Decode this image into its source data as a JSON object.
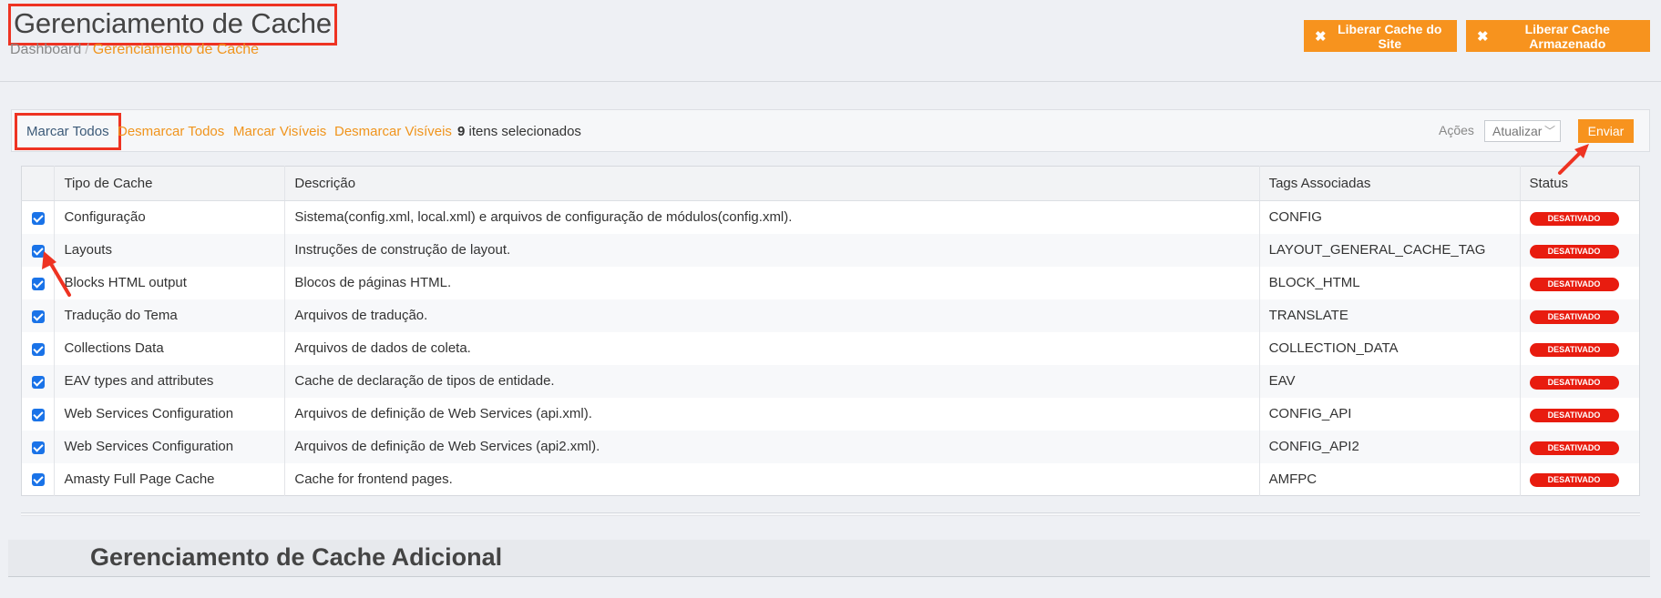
{
  "header": {
    "title": "Gerenciamento de Cache",
    "breadcrumb": {
      "home": "Dashboard",
      "separator": "/",
      "current": "Gerenciamento de Cache"
    },
    "buttons": {
      "liberar_site": "Liberar Cache do Site",
      "liberar_armazenado": "Liberar Cache Armazenado"
    }
  },
  "massaction": {
    "marcar_todos": "Marcar Todos",
    "desmarcar_todos": "Desmarcar Todos",
    "marcar_visiveis": "Marcar Visíveis",
    "desmarcar_visiveis": "Desmarcar Visíveis",
    "selected_count": "9",
    "selected_label": "itens selecionados",
    "acoes_label": "Ações",
    "acoes_selected": "Atualizar",
    "enviar": "Enviar"
  },
  "grid": {
    "columns": [
      "Tipo de Cache",
      "Descrição",
      "Tags Associadas",
      "Status"
    ],
    "rows": [
      {
        "checked": true,
        "tipo": "Configuração",
        "descricao": "Sistema(config.xml, local.xml) e arquivos de configuração de módulos(config.xml).",
        "tags": "CONFIG",
        "status": "DESATIVADO"
      },
      {
        "checked": true,
        "tipo": "Layouts",
        "descricao": "Instruções de construção de layout.",
        "tags": "LAYOUT_GENERAL_CACHE_TAG",
        "status": "DESATIVADO"
      },
      {
        "checked": true,
        "tipo": "Blocks HTML output",
        "descricao": "Blocos de páginas HTML.",
        "tags": "BLOCK_HTML",
        "status": "DESATIVADO"
      },
      {
        "checked": true,
        "tipo": "Tradução do Tema",
        "descricao": "Arquivos de tradução.",
        "tags": "TRANSLATE",
        "status": "DESATIVADO"
      },
      {
        "checked": true,
        "tipo": "Collections Data",
        "descricao": "Arquivos de dados de coleta.",
        "tags": "COLLECTION_DATA",
        "status": "DESATIVADO"
      },
      {
        "checked": true,
        "tipo": "EAV types and attributes",
        "descricao": "Cache de declaração de tipos de entidade.",
        "tags": "EAV",
        "status": "DESATIVADO"
      },
      {
        "checked": true,
        "tipo": "Web Services Configuration",
        "descricao": "Arquivos de definição de Web Services (api.xml).",
        "tags": "CONFIG_API",
        "status": "DESATIVADO"
      },
      {
        "checked": true,
        "tipo": "Web Services Configuration",
        "descricao": "Arquivos de definição de Web Services (api2.xml).",
        "tags": "CONFIG_API2",
        "status": "DESATIVADO"
      },
      {
        "checked": true,
        "tipo": "Amasty Full Page Cache",
        "descricao": "Cache for frontend pages.",
        "tags": "AMFPC",
        "status": "DESATIVADO"
      }
    ]
  },
  "section2": {
    "title": "Gerenciamento de Cache Adicional"
  },
  "colors": {
    "accent": "#f7931e",
    "badge": "#e81c0f",
    "highlight": "#ee3322",
    "checkbox": "#1a73e8"
  },
  "icons": {
    "button_icon": "close-icon",
    "annotation": "red-arrow-icon"
  }
}
